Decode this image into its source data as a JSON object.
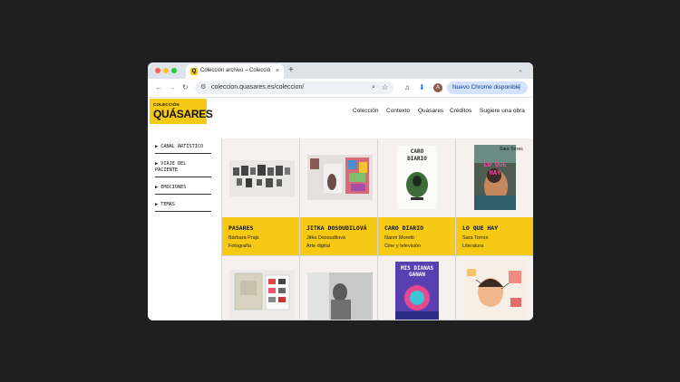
{
  "browser": {
    "tab_title": "Colección archivo – Colecció",
    "tab_favicon_letter": "Q",
    "tab_close": "×",
    "new_tab": "+",
    "tab_menu": "⌄",
    "back": "←",
    "forward": "→",
    "reload": "↻",
    "url": "coleccion.quasares.es/coleccion/",
    "profile_initial": "A",
    "update_button": "Nuevo Chrome disponible",
    "update_menu": "⋮"
  },
  "site": {
    "logo_small": "COLECCIÓN",
    "logo_big": "QUÁSARES",
    "accent_color": "#f6c915",
    "nav": [
      "Colección",
      "Contexto",
      "Quásares",
      "Créditos",
      "Sugiere una obra"
    ]
  },
  "sidebar": {
    "items": [
      {
        "arrow": "▶",
        "label": "CANAL ARTÍSTICO"
      },
      {
        "arrow": "▶",
        "label": "VIAJE DEL PACIENTE"
      },
      {
        "arrow": "▶",
        "label": "EMOCIONES"
      },
      {
        "arrow": "▶",
        "label": "TEMAS"
      }
    ]
  },
  "cards": [
    {
      "title": "PASARES",
      "author": "Bárbara Prajs",
      "category": "Fotografía"
    },
    {
      "title": "JITKA DOSOUDILOVÁ",
      "author": "Jitka Dosoudilová",
      "category": "Arte digital"
    },
    {
      "title": "CARO DIARIO",
      "author": "Nanni Moretti",
      "category": "Cine y televisión",
      "cover_text": "CARO DIARIO"
    },
    {
      "title": "LO QUE HAY",
      "author": "Sara Torres",
      "category": "Literatura",
      "cover_author": "Sara Torres",
      "cover_text": "LO QUE HAY"
    },
    {},
    {},
    {
      "cover_text": "MIS DIANAS GANAN"
    },
    {}
  ]
}
